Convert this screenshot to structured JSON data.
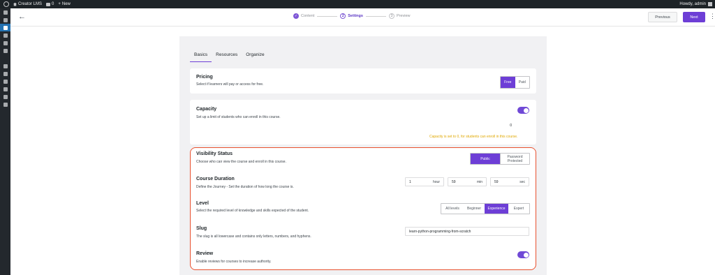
{
  "adminbar": {
    "site_name": "Creator LMS",
    "comments_count": "0",
    "new_label": "New",
    "howdy": "Howdy, admin"
  },
  "sidebar": {
    "items": [
      "dashboard-icon",
      "pin-icon",
      "courses-icon",
      "media-icon",
      "pages-icon",
      "comments-icon",
      "appearance-icon",
      "plugins-icon",
      "users-icon",
      "tools-icon",
      "settings-icon",
      "collapse-icon"
    ]
  },
  "topbar": {
    "back_icon": "←",
    "steps": [
      {
        "num": "✓",
        "label": "Content"
      },
      {
        "num": "2",
        "label": "Settings"
      },
      {
        "num": "3",
        "label": "Preview"
      }
    ],
    "previous_label": "Previous",
    "next_label": "Next",
    "more_icon": "⋮"
  },
  "tabs": [
    "Basics",
    "Resources",
    "Organize"
  ],
  "pricing": {
    "title": "Pricing",
    "description": "Select if learners will pay or access for free.",
    "options": [
      "Free",
      "Paid"
    ],
    "selected": "Free"
  },
  "capacity": {
    "title": "Capacity",
    "description": "Set up a limit of students who can enroll in this course.",
    "enabled": true,
    "value": "0",
    "warning": "Capacity is set to 0, for students can enroll in this course."
  },
  "visibility": {
    "title": "Visibility Status",
    "description": "Choose who can view the course and enroll in this course.",
    "options": [
      "Public",
      "Password Protected"
    ],
    "selected": "Public"
  },
  "duration": {
    "title": "Course Duration",
    "description": "Define the Journey - Set the duration of how long the course is.",
    "hours": "1",
    "hours_unit": "hour",
    "mins": "59",
    "mins_unit": "min",
    "secs": "59",
    "secs_unit": "sec"
  },
  "level": {
    "title": "Level",
    "description": "Select the required level of knowledge and skills expected of the student.",
    "options": [
      "All levels",
      "Beginner",
      "Experience",
      "Expert"
    ],
    "selected": "Experience"
  },
  "slug": {
    "title": "Slug",
    "description": "The slug is all lowercase and contains only letters, numbers, and hyphens.",
    "value": "learn-python-programming-from-scratch"
  },
  "review": {
    "title": "Review",
    "description": "Enable reviews for courses to increase authority.",
    "enabled": true
  },
  "colors": {
    "accent": "#6d3ed6",
    "highlight": "#e8502e",
    "warning": "#e0a800",
    "adminbar": "#1d2327"
  }
}
